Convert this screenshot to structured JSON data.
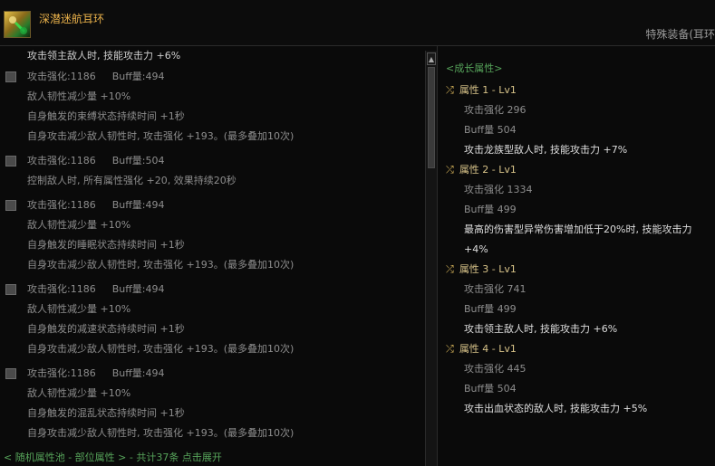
{
  "item": {
    "name": "深潜迷航耳环",
    "type": "特殊装备(耳环"
  },
  "left_panel": {
    "cut_line": "攻击领主敌人时, 技能攻击力 +6%",
    "options": [
      {
        "stat_a": "攻击强化:1186",
        "stat_b": "Buff量:494",
        "lines": [
          "敌人韧性减少量 +10%",
          "自身触发的束缚状态持续时间 +1秒",
          "自身攻击减少敌人韧性时, 攻击强化 +193。(最多叠加10次)"
        ]
      },
      {
        "stat_a": "攻击强化:1186",
        "stat_b": "Buff量:504",
        "lines": [
          "控制敌人时, 所有属性强化 +20, 效果持续20秒"
        ]
      },
      {
        "stat_a": "攻击强化:1186",
        "stat_b": "Buff量:494",
        "lines": [
          "敌人韧性减少量 +10%",
          "自身触发的睡眠状态持续时间 +1秒",
          "自身攻击减少敌人韧性时, 攻击强化 +193。(最多叠加10次)"
        ]
      },
      {
        "stat_a": "攻击强化:1186",
        "stat_b": "Buff量:494",
        "lines": [
          "敌人韧性减少量 +10%",
          "自身触发的减速状态持续时间 +1秒",
          "自身攻击减少敌人韧性时, 攻击强化 +193。(最多叠加10次)"
        ]
      },
      {
        "stat_a": "攻击强化:1186",
        "stat_b": "Buff量:494",
        "lines": [
          "敌人韧性减少量 +10%",
          "自身触发的混乱状态持续时间 +1秒",
          "自身攻击减少敌人韧性时, 攻击强化 +193。(最多叠加10次)"
        ]
      }
    ],
    "footer": "< 随机属性池 - 部位属性 > - 共计37条 点击展开"
  },
  "right_panel": {
    "title": "<成长属性>",
    "attributes": [
      {
        "header": "属性 1 - Lv1",
        "attack": "攻击强化 296",
        "buff": "Buff量 504",
        "effect": [
          "攻击龙族型敌人时, 技能攻击力 +7%"
        ]
      },
      {
        "header": "属性 2 - Lv1",
        "attack": "攻击强化 1334",
        "buff": "Buff量 499",
        "effect": [
          "最高的伤害型异常伤害增加低于20%时, 技能攻击力",
          "+4%"
        ]
      },
      {
        "header": "属性 3 - Lv1",
        "attack": "攻击强化 741",
        "buff": "Buff量 499",
        "effect": [
          "攻击领主敌人时, 技能攻击力 +6%"
        ]
      },
      {
        "header": "属性 4 - Lv1",
        "attack": "攻击强化 445",
        "buff": "Buff量 504",
        "effect": [
          "攻击出血状态的敌人时, 技能攻击力 +5%"
        ]
      }
    ]
  },
  "colors": {
    "item_name": "#e8b04a",
    "growth_title": "#56a35a",
    "attr_header": "#d9c48a",
    "effect_text": "#dedede",
    "muted_text": "#8d8d8d"
  },
  "icons": {
    "item": "earring-icon",
    "shuffle": "shuffle-icon",
    "scroll_up": "arrow-up-icon",
    "checkbox": "checkbox-icon"
  }
}
